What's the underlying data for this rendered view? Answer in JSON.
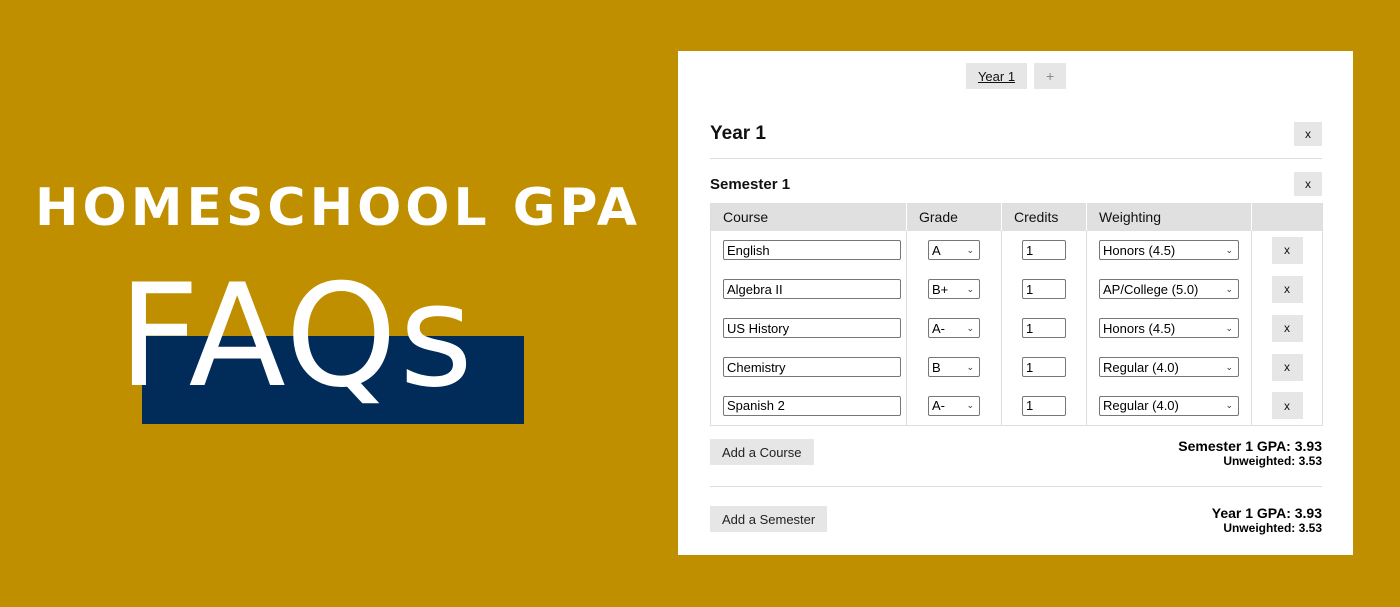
{
  "hero": {
    "title": "HOMESCHOOL GPA",
    "subtitle": "FAQs",
    "colors": {
      "background": "#bf8f00",
      "accent_box": "#012c5a",
      "text": "#ffffff"
    }
  },
  "tabs": [
    {
      "label": "Year 1",
      "active": true
    },
    {
      "label": "+",
      "icon": "plus-icon"
    }
  ],
  "year": {
    "title": "Year 1",
    "remove_label": "x",
    "semester": {
      "title": "Semester 1",
      "remove_label": "x",
      "columns": [
        "Course",
        "Grade",
        "Credits",
        "Weighting",
        ""
      ],
      "rows": [
        {
          "course": "English",
          "grade": "A",
          "credits": "1",
          "weighting": "Honors (4.5)",
          "remove": "x"
        },
        {
          "course": "Algebra II",
          "grade": "B+",
          "credits": "1",
          "weighting": "AP/College (5.0)",
          "remove": "x"
        },
        {
          "course": "US History",
          "grade": "A-",
          "credits": "1",
          "weighting": "Honors (4.5)",
          "remove": "x"
        },
        {
          "course": "Chemistry",
          "grade": "B",
          "credits": "1",
          "weighting": "Regular (4.0)",
          "remove": "x"
        },
        {
          "course": "Spanish 2",
          "grade": "A-",
          "credits": "1",
          "weighting": "Regular (4.0)",
          "remove": "x"
        }
      ],
      "add_course_label": "Add a Course",
      "gpa_label": "Semester 1 GPA: 3.93",
      "unweighted_label": "Unweighted: 3.53"
    },
    "add_semester_label": "Add a Semester",
    "gpa_label": "Year 1 GPA: 3.93",
    "unweighted_label": "Unweighted: 3.53"
  }
}
